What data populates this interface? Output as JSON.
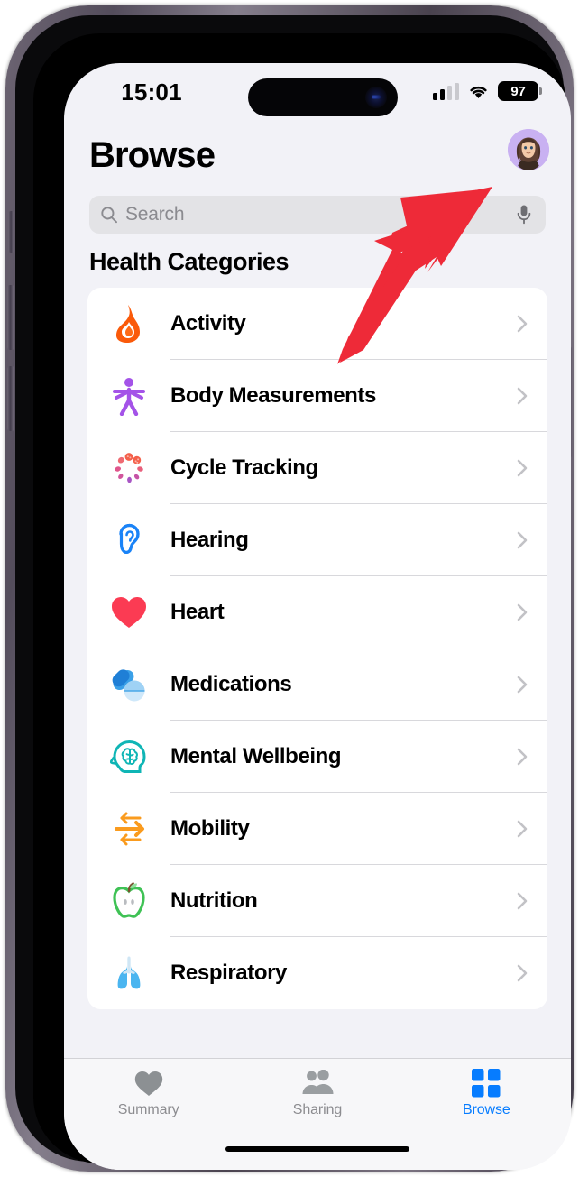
{
  "status_bar": {
    "time": "15:01",
    "cellular_bars_filled": 2,
    "cellular_bars_total": 4,
    "wifi_icon": "wifi-icon",
    "battery_percent": "97"
  },
  "header": {
    "title": "Browse",
    "avatar_icon": "memoji-avatar",
    "avatar_bg_color": "#c9b1f2"
  },
  "search": {
    "placeholder": "Search",
    "value": "",
    "search_icon": "search-icon",
    "mic_icon": "microphone-icon"
  },
  "main": {
    "section_title": "Health Categories",
    "categories": [
      {
        "label": "Activity",
        "icon": "flame-icon",
        "color": "#fa5a0a"
      },
      {
        "label": "Body Measurements",
        "icon": "body-figure-icon",
        "color": "#a453e8"
      },
      {
        "label": "Cycle Tracking",
        "icon": "cycle-petals-icon",
        "color": "#e8506e"
      },
      {
        "label": "Hearing",
        "icon": "ear-icon",
        "color": "#1a83f7"
      },
      {
        "label": "Heart",
        "icon": "heart-icon",
        "color": "#fb3b53"
      },
      {
        "label": "Medications",
        "icon": "pills-icon",
        "color": "#3aa0e8"
      },
      {
        "label": "Mental Wellbeing",
        "icon": "brain-head-icon",
        "color": "#0fb5b5"
      },
      {
        "label": "Mobility",
        "icon": "arrows-icon",
        "color": "#fa9b1e"
      },
      {
        "label": "Nutrition",
        "icon": "apple-icon",
        "color": "#3fc255"
      },
      {
        "label": "Respiratory",
        "icon": "lungs-icon",
        "color": "#4ab5f0"
      }
    ],
    "chevron_icon": "chevron-right-icon"
  },
  "tab_bar": {
    "active_color": "#067cff",
    "inactive_color": "#8c8c90",
    "tabs": [
      {
        "label": "Summary",
        "icon": "heart-icon",
        "active": false
      },
      {
        "label": "Sharing",
        "icon": "people-icon",
        "active": false
      },
      {
        "label": "Browse",
        "icon": "grid-squares-icon",
        "active": true
      }
    ]
  },
  "annotation": {
    "arrow_icon": "red-arrow-up-right",
    "arrow_color": "#ee2a38",
    "points_at": "avatar"
  }
}
